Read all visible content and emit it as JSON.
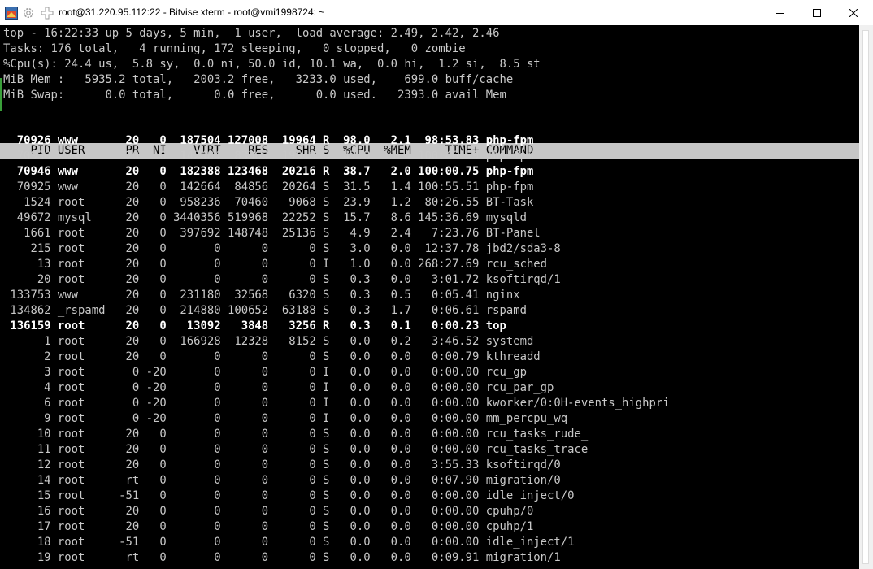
{
  "window": {
    "title": "root@31.220.95.112:22 - Bitvise xterm - root@vmi1998724: ~",
    "icons": [
      "terminal-app-icon",
      "gear-icon",
      "plus-icon"
    ]
  },
  "top": {
    "summary": [
      "top - 16:22:33 up 5 days, 5 min,  1 user,  load average: 2.49, 2.42, 2.46",
      "Tasks: 176 total,   4 running, 172 sleeping,   0 stopped,   0 zombie",
      "%Cpu(s): 24.4 us,  5.8 sy,  0.0 ni, 50.0 id, 10.1 wa,  0.0 hi,  1.2 si,  8.5 st",
      "MiB Mem :   5935.2 total,   2003.2 free,   3233.0 used,    699.0 buff/cache",
      "MiB Swap:      0.0 total,      0.0 free,      0.0 used.   2393.0 avail Mem"
    ],
    "columns": [
      "PID",
      "USER",
      "PR",
      "NI",
      "VIRT",
      "RES",
      "SHR",
      "S",
      "%CPU",
      "%MEM",
      "TIME+",
      "COMMAND"
    ],
    "rows": [
      {
        "pid": "70926",
        "user": "www",
        "pr": "20",
        "ni": "0",
        "virt": "187504",
        "res": "127008",
        "shr": "19964",
        "s": "R",
        "cpu": "98.0",
        "mem": "2.1",
        "time": "98:53.83",
        "cmd": "php-fpm",
        "bold": true
      },
      {
        "pid": "70930",
        "user": "www",
        "pr": "20",
        "ni": "0",
        "virt": "142484",
        "res": "83360",
        "shr": "19948",
        "s": "S",
        "cpu": "47.9",
        "mem": "1.4",
        "time": "100:46.59",
        "cmd": "php-fpm",
        "bold": false
      },
      {
        "pid": "70946",
        "user": "www",
        "pr": "20",
        "ni": "0",
        "virt": "182388",
        "res": "123468",
        "shr": "20216",
        "s": "R",
        "cpu": "38.7",
        "mem": "2.0",
        "time": "100:00.75",
        "cmd": "php-fpm",
        "bold": true
      },
      {
        "pid": "70925",
        "user": "www",
        "pr": "20",
        "ni": "0",
        "virt": "142664",
        "res": "84856",
        "shr": "20264",
        "s": "S",
        "cpu": "31.5",
        "mem": "1.4",
        "time": "100:55.51",
        "cmd": "php-fpm",
        "bold": false
      },
      {
        "pid": "1524",
        "user": "root",
        "pr": "20",
        "ni": "0",
        "virt": "958236",
        "res": "70460",
        "shr": "9068",
        "s": "S",
        "cpu": "23.9",
        "mem": "1.2",
        "time": "80:26.55",
        "cmd": "BT-Task",
        "bold": false
      },
      {
        "pid": "49672",
        "user": "mysql",
        "pr": "20",
        "ni": "0",
        "virt": "3440356",
        "res": "519968",
        "shr": "22252",
        "s": "S",
        "cpu": "15.7",
        "mem": "8.6",
        "time": "145:36.69",
        "cmd": "mysqld",
        "bold": false
      },
      {
        "pid": "1661",
        "user": "root",
        "pr": "20",
        "ni": "0",
        "virt": "397692",
        "res": "148748",
        "shr": "25136",
        "s": "S",
        "cpu": "4.9",
        "mem": "2.4",
        "time": "7:23.76",
        "cmd": "BT-Panel",
        "bold": false
      },
      {
        "pid": "215",
        "user": "root",
        "pr": "20",
        "ni": "0",
        "virt": "0",
        "res": "0",
        "shr": "0",
        "s": "S",
        "cpu": "3.0",
        "mem": "0.0",
        "time": "12:37.78",
        "cmd": "jbd2/sda3-8",
        "bold": false
      },
      {
        "pid": "13",
        "user": "root",
        "pr": "20",
        "ni": "0",
        "virt": "0",
        "res": "0",
        "shr": "0",
        "s": "I",
        "cpu": "1.0",
        "mem": "0.0",
        "time": "268:27.69",
        "cmd": "rcu_sched",
        "bold": false
      },
      {
        "pid": "20",
        "user": "root",
        "pr": "20",
        "ni": "0",
        "virt": "0",
        "res": "0",
        "shr": "0",
        "s": "S",
        "cpu": "0.3",
        "mem": "0.0",
        "time": "3:01.72",
        "cmd": "ksoftirqd/1",
        "bold": false
      },
      {
        "pid": "133753",
        "user": "www",
        "pr": "20",
        "ni": "0",
        "virt": "231180",
        "res": "32568",
        "shr": "6320",
        "s": "S",
        "cpu": "0.3",
        "mem": "0.5",
        "time": "0:05.41",
        "cmd": "nginx",
        "bold": false
      },
      {
        "pid": "134862",
        "user": "_rspamd",
        "pr": "20",
        "ni": "0",
        "virt": "214880",
        "res": "100652",
        "shr": "63188",
        "s": "S",
        "cpu": "0.3",
        "mem": "1.7",
        "time": "0:06.61",
        "cmd": "rspamd",
        "bold": false
      },
      {
        "pid": "136159",
        "user": "root",
        "pr": "20",
        "ni": "0",
        "virt": "13092",
        "res": "3848",
        "shr": "3256",
        "s": "R",
        "cpu": "0.3",
        "mem": "0.1",
        "time": "0:00.23",
        "cmd": "top",
        "bold": true
      },
      {
        "pid": "1",
        "user": "root",
        "pr": "20",
        "ni": "0",
        "virt": "166928",
        "res": "12328",
        "shr": "8152",
        "s": "S",
        "cpu": "0.0",
        "mem": "0.2",
        "time": "3:46.52",
        "cmd": "systemd",
        "bold": false
      },
      {
        "pid": "2",
        "user": "root",
        "pr": "20",
        "ni": "0",
        "virt": "0",
        "res": "0",
        "shr": "0",
        "s": "S",
        "cpu": "0.0",
        "mem": "0.0",
        "time": "0:00.79",
        "cmd": "kthreadd",
        "bold": false
      },
      {
        "pid": "3",
        "user": "root",
        "pr": "0",
        "ni": "-20",
        "virt": "0",
        "res": "0",
        "shr": "0",
        "s": "I",
        "cpu": "0.0",
        "mem": "0.0",
        "time": "0:00.00",
        "cmd": "rcu_gp",
        "bold": false
      },
      {
        "pid": "4",
        "user": "root",
        "pr": "0",
        "ni": "-20",
        "virt": "0",
        "res": "0",
        "shr": "0",
        "s": "I",
        "cpu": "0.0",
        "mem": "0.0",
        "time": "0:00.00",
        "cmd": "rcu_par_gp",
        "bold": false
      },
      {
        "pid": "6",
        "user": "root",
        "pr": "0",
        "ni": "-20",
        "virt": "0",
        "res": "0",
        "shr": "0",
        "s": "I",
        "cpu": "0.0",
        "mem": "0.0",
        "time": "0:00.00",
        "cmd": "kworker/0:0H-events_highpri",
        "bold": false
      },
      {
        "pid": "9",
        "user": "root",
        "pr": "0",
        "ni": "-20",
        "virt": "0",
        "res": "0",
        "shr": "0",
        "s": "I",
        "cpu": "0.0",
        "mem": "0.0",
        "time": "0:00.00",
        "cmd": "mm_percpu_wq",
        "bold": false
      },
      {
        "pid": "10",
        "user": "root",
        "pr": "20",
        "ni": "0",
        "virt": "0",
        "res": "0",
        "shr": "0",
        "s": "S",
        "cpu": "0.0",
        "mem": "0.0",
        "time": "0:00.00",
        "cmd": "rcu_tasks_rude_",
        "bold": false
      },
      {
        "pid": "11",
        "user": "root",
        "pr": "20",
        "ni": "0",
        "virt": "0",
        "res": "0",
        "shr": "0",
        "s": "S",
        "cpu": "0.0",
        "mem": "0.0",
        "time": "0:00.00",
        "cmd": "rcu_tasks_trace",
        "bold": false
      },
      {
        "pid": "12",
        "user": "root",
        "pr": "20",
        "ni": "0",
        "virt": "0",
        "res": "0",
        "shr": "0",
        "s": "S",
        "cpu": "0.0",
        "mem": "0.0",
        "time": "3:55.33",
        "cmd": "ksoftirqd/0",
        "bold": false
      },
      {
        "pid": "14",
        "user": "root",
        "pr": "rt",
        "ni": "0",
        "virt": "0",
        "res": "0",
        "shr": "0",
        "s": "S",
        "cpu": "0.0",
        "mem": "0.0",
        "time": "0:07.90",
        "cmd": "migration/0",
        "bold": false
      },
      {
        "pid": "15",
        "user": "root",
        "pr": "-51",
        "ni": "0",
        "virt": "0",
        "res": "0",
        "shr": "0",
        "s": "S",
        "cpu": "0.0",
        "mem": "0.0",
        "time": "0:00.00",
        "cmd": "idle_inject/0",
        "bold": false
      },
      {
        "pid": "16",
        "user": "root",
        "pr": "20",
        "ni": "0",
        "virt": "0",
        "res": "0",
        "shr": "0",
        "s": "S",
        "cpu": "0.0",
        "mem": "0.0",
        "time": "0:00.00",
        "cmd": "cpuhp/0",
        "bold": false
      },
      {
        "pid": "17",
        "user": "root",
        "pr": "20",
        "ni": "0",
        "virt": "0",
        "res": "0",
        "shr": "0",
        "s": "S",
        "cpu": "0.0",
        "mem": "0.0",
        "time": "0:00.00",
        "cmd": "cpuhp/1",
        "bold": false
      },
      {
        "pid": "18",
        "user": "root",
        "pr": "-51",
        "ni": "0",
        "virt": "0",
        "res": "0",
        "shr": "0",
        "s": "S",
        "cpu": "0.0",
        "mem": "0.0",
        "time": "0:00.00",
        "cmd": "idle_inject/1",
        "bold": false
      },
      {
        "pid": "19",
        "user": "root",
        "pr": "rt",
        "ni": "0",
        "virt": "0",
        "res": "0",
        "shr": "0",
        "s": "S",
        "cpu": "0.0",
        "mem": "0.0",
        "time": "0:09.91",
        "cmd": "migration/1",
        "bold": false
      }
    ]
  },
  "colors": {
    "terminal_bg": "#000000",
    "terminal_fg": "#c8c8c8",
    "header_bg": "#c6c6c6",
    "bold_fg": "#ffffff"
  }
}
